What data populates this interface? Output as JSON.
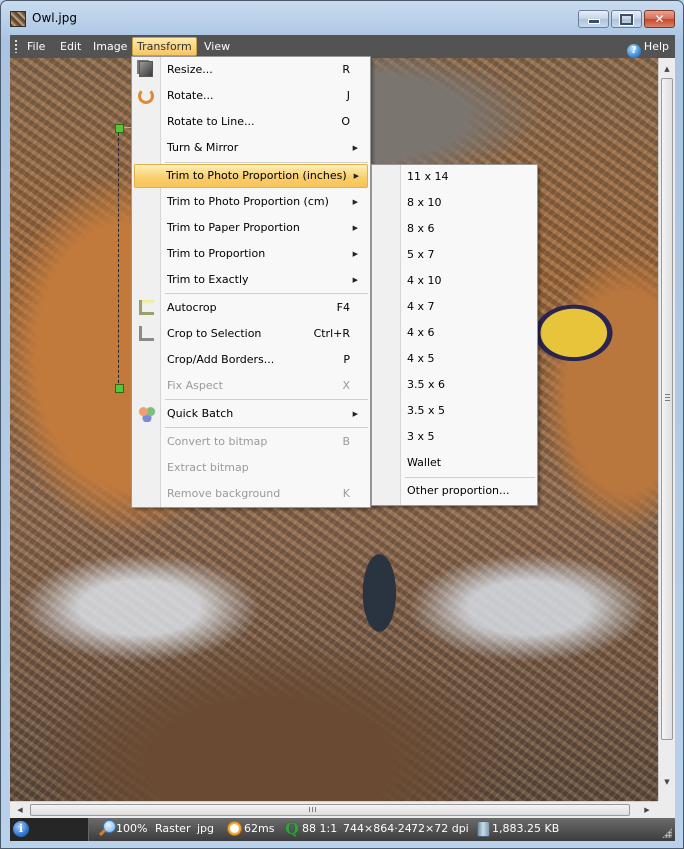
{
  "window": {
    "title": "Owl.jpg",
    "controls": {
      "minimize": "minimize",
      "maximize": "maximize",
      "close": "✕"
    }
  },
  "menubar": {
    "items": [
      {
        "label": "File",
        "mnemonic": "F"
      },
      {
        "label": "Edit",
        "mnemonic": "E"
      },
      {
        "label": "Image",
        "mnemonic": "I"
      },
      {
        "label": "Transform",
        "mnemonic": "T",
        "active": true
      },
      {
        "label": "View",
        "mnemonic": "V"
      }
    ],
    "help": "Help"
  },
  "transform_menu": {
    "items": [
      {
        "label": "Resize...",
        "shortcut": "R",
        "icon": "resize-icon"
      },
      {
        "label": "Rotate...",
        "shortcut": "J",
        "icon": "rotate-icon"
      },
      {
        "label": "Rotate to Line...",
        "shortcut": "O"
      },
      {
        "label": "Turn & Mirror",
        "submenu": true
      },
      {
        "label": "Trim to Photo Proportion (inches)",
        "submenu": true,
        "highlighted": true
      },
      {
        "label": "Trim to Photo Proportion (cm)",
        "submenu": true
      },
      {
        "label": "Trim to Paper Proportion",
        "submenu": true
      },
      {
        "label": "Trim to Proportion",
        "submenu": true
      },
      {
        "label": "Trim to Exactly",
        "submenu": true
      },
      {
        "label": "Autocrop",
        "shortcut": "F4",
        "icon": "autocrop-icon"
      },
      {
        "label": "Crop to Selection",
        "shortcut": "Ctrl+R",
        "icon": "crop-icon"
      },
      {
        "label": "Crop/Add Borders...",
        "shortcut": "P"
      },
      {
        "label": "Fix Aspect",
        "shortcut": "X",
        "disabled": true
      },
      {
        "label": "Quick Batch",
        "submenu": true,
        "icon": "batch-icon"
      },
      {
        "label": "Convert to bitmap",
        "shortcut": "B",
        "disabled": true
      },
      {
        "label": "Extract bitmap",
        "disabled": true
      },
      {
        "label": "Remove background",
        "shortcut": "K",
        "disabled": true
      }
    ],
    "submenu_arrow": "▶"
  },
  "proportion_menu": {
    "items": [
      "11 x 14",
      "8 x 10",
      "8 x 6",
      "5 x 7",
      "4 x 10",
      "4 x 7",
      "4 x 6",
      "4 x 5",
      "3.5 x 6",
      "3.5 x 5",
      "3 x 5",
      "Wallet"
    ],
    "other": "Other proportion..."
  },
  "scrollbars": {
    "up": "▲",
    "down": "▼",
    "left": "◀",
    "right": "▶"
  },
  "statusbar": {
    "info_icon": "i",
    "zoom": "100%",
    "type": "Raster",
    "format": "jpg",
    "load_time": "62ms",
    "quality": "88 1:1",
    "dimensions": "744×864·24",
    "dpi": "72×72 dpi",
    "file_size": "1,883.25 KB",
    "quality_icon": "Q"
  },
  "colors": {
    "menubar_bg": "#535353",
    "highlight": "#f9cd6a",
    "statusbar_bg": "#3c3c3c"
  }
}
